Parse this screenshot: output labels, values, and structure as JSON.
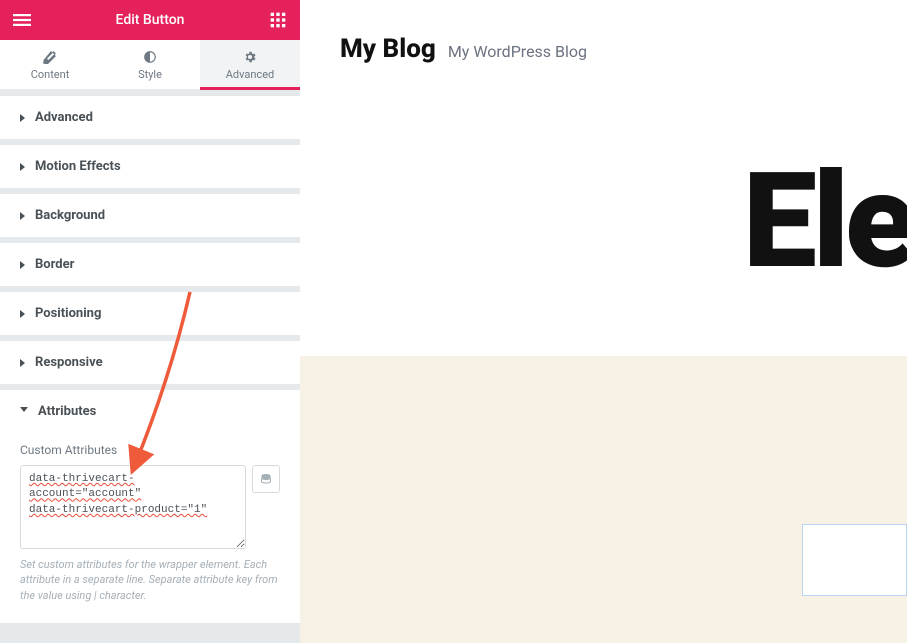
{
  "topbar": {
    "title": "Edit Button"
  },
  "tabs": {
    "content": "Content",
    "style": "Style",
    "advanced": "Advanced"
  },
  "sections": {
    "advanced": "Advanced",
    "motion": "Motion Effects",
    "background": "Background",
    "border": "Border",
    "positioning": "Positioning",
    "responsive": "Responsive",
    "attributes": "Attributes"
  },
  "attributes_panel": {
    "label": "Custom Attributes",
    "textarea_value": "data-thrivecart-account=\"account\"\ndata-thrivecart-product=\"1\"",
    "helper": "Set custom attributes for the wrapper element. Each attribute in a separate line. Separate attribute key from the value using | character."
  },
  "preview": {
    "site_title": "My Blog",
    "site_tagline": "My WordPress Blog",
    "big_text": "Ele"
  }
}
